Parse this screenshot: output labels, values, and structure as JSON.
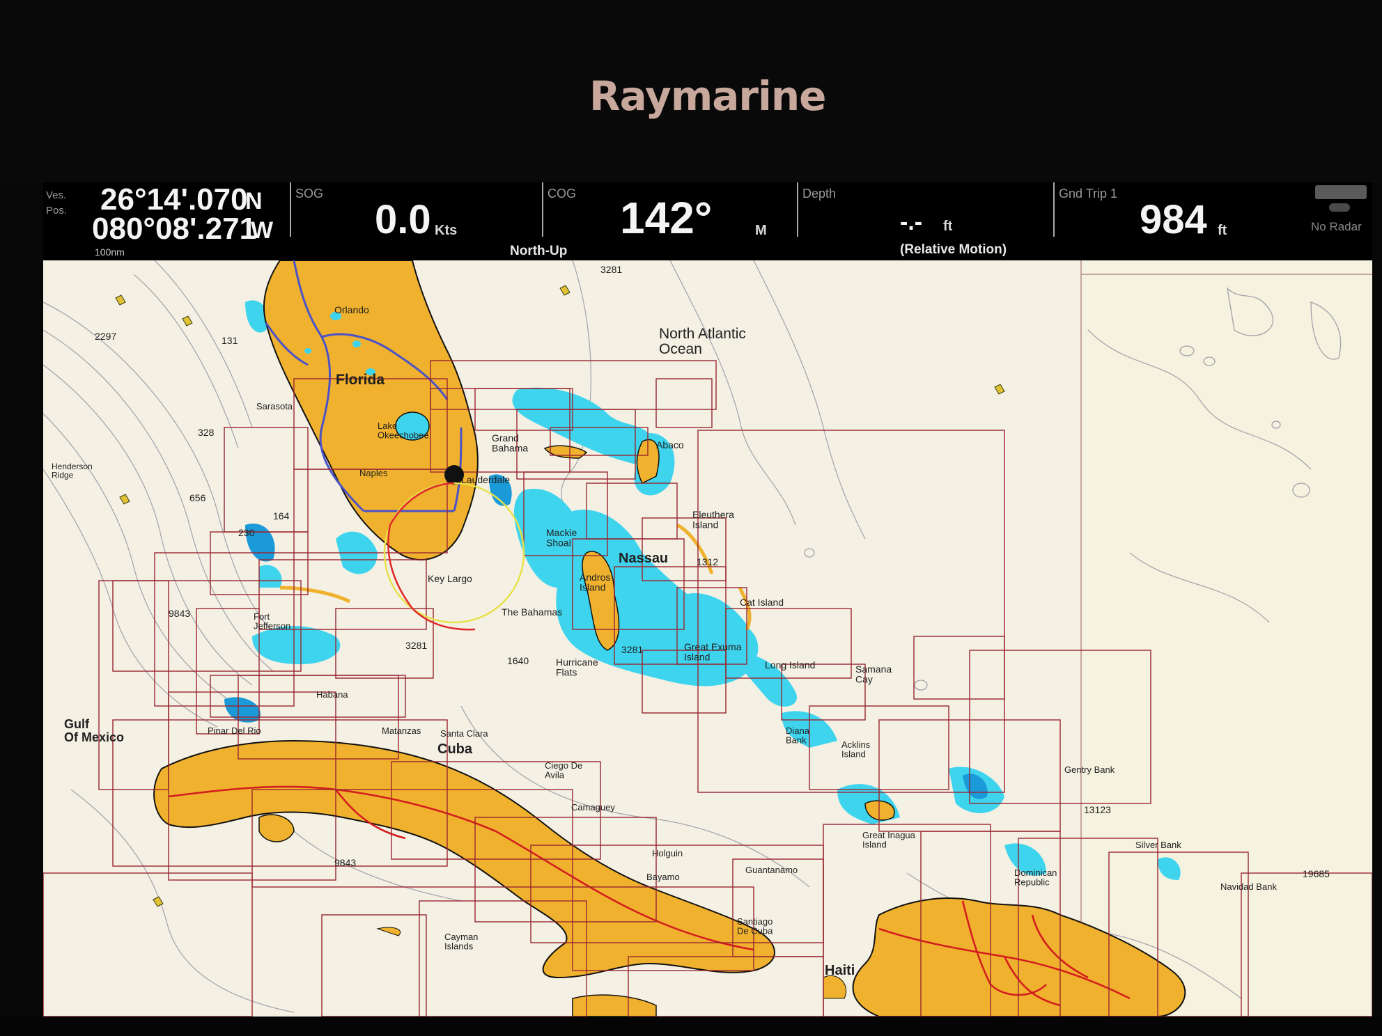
{
  "brand": "Raymarine",
  "position": {
    "label_line1": "Ves.",
    "label_line2": "Pos.",
    "lat": "26°14'.070",
    "lat_hemi": "N",
    "lon": "080°08'.271",
    "lon_hemi": "W",
    "scale": "100nm"
  },
  "sog": {
    "label": "SOG",
    "value": "0.0",
    "unit": "Kts"
  },
  "cog": {
    "label": "COG",
    "value": "142°",
    "unit": "M"
  },
  "orientation": "North-Up",
  "depth": {
    "label": "Depth",
    "value": "-.-",
    "unit": "ft",
    "motion": "(Relative Motion)"
  },
  "trip": {
    "label": "Gnd Trip 1",
    "value": "984",
    "unit": "ft"
  },
  "radar_status": "No Radar",
  "map": {
    "colors": {
      "land": "#f0b22e",
      "shallow": "#3ed4ee",
      "deep_shallow": "#1a9ad8",
      "sea": "#f4f1e4",
      "chart_boundary": "#9a2630",
      "road": "#d41e1e",
      "contour": "#8c8c9c",
      "highway": "#4b52c8"
    },
    "labels": {
      "ocean": "North Atlantic\nOcean",
      "florida": "Florida",
      "nassau": "Nassau",
      "cuba": "Cuba",
      "haiti": "Haiti",
      "gulf": "Gulf\nOf Mexico",
      "orlando": "Orlando",
      "grand_bahama": "Grand\nBahama",
      "abaco": "Abaco",
      "eleuthera": "Eleuthera\nIsland",
      "lauderdale": "Lauderdale",
      "key_largo": "Key Largo",
      "the_bahamas": "The Bahamas",
      "andros": "Andros\nIsland",
      "mackie": "Mackie\nShoal",
      "hurricane": "Hurricane\nFlats",
      "great_exuma": "Great Exuma\nIsland",
      "long_island": "Long Island",
      "cat_island": "Cat Island",
      "samana": "Samana\nCay",
      "habana": "Habana",
      "matanzas": "Matanzas",
      "santa_clara": "Santa Clara",
      "ciego": "Ciego De\nAvila",
      "camaguey": "Camaguey",
      "holguin": "Holguin",
      "bayamo": "Bayamo",
      "guantanamo": "Guantanamo",
      "santiago": "Santiago\nDe Cuba",
      "cayman": "Cayman\nIslands",
      "pinar": "Pinar Del Rio",
      "fort_jefferson": "Fort\nJefferson",
      "henderson": "Henderson\nRidge",
      "great_inagua": "Great Inagua\nIsland",
      "acklins": "Acklins\nIsland",
      "diana": "Diana\nBank",
      "gentry": "Gentry Bank",
      "silver": "Silver Bank",
      "navidad": "Navidad Bank",
      "dominican": "Dominican\nRepublic",
      "lakeo": "Lake\nOkeechobee",
      "naples": "Naples",
      "sarasota": "Sarasota"
    },
    "depths": [
      "3281",
      "9843",
      "328",
      "656",
      "164",
      "230",
      "131",
      "1640",
      "3281",
      "9843",
      "13123",
      "19685",
      "2297",
      "1312",
      "3281"
    ]
  }
}
